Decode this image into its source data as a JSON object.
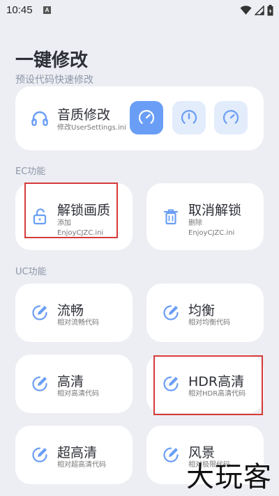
{
  "status_bar": {
    "time": "10:45",
    "app_badge": "A",
    "icons": [
      "wifi-icon",
      "signal-icon",
      "battery-icon"
    ]
  },
  "header": {
    "title": "一键修改",
    "subtitle": "预设代码快速修改"
  },
  "audio_card": {
    "title": "音质修改",
    "subtitle": "修改UserSettings.ini",
    "icon": "headphones-icon",
    "options": [
      {
        "icon": "gauge-high-icon",
        "active": true
      },
      {
        "icon": "gauge-mid-icon",
        "active": false
      },
      {
        "icon": "gauge-low-icon",
        "active": false
      }
    ]
  },
  "ec_section": {
    "label": "EC功能",
    "cards": [
      {
        "title": "解锁画质",
        "sub1": "添加",
        "sub2": "EnjoyCJZC.ini",
        "icon": "lock-open-icon"
      },
      {
        "title": "取消解锁",
        "sub1": "删除",
        "sub2": "EnjoyCJZC.ini",
        "icon": "trash-icon"
      }
    ]
  },
  "uc_section": {
    "label": "UC功能",
    "cards": [
      {
        "title": "流畅",
        "sub": "相对流畅代码",
        "icon": "edit-icon"
      },
      {
        "title": "均衡",
        "sub": "相对均衡代码",
        "icon": "edit-icon"
      },
      {
        "title": "高清",
        "sub": "相对高清代码",
        "icon": "edit-icon"
      },
      {
        "title": "HDR高清",
        "sub": "相对HDR高清代码",
        "icon": "edit-icon"
      },
      {
        "title": "超高清",
        "sub": "相对超高清代码",
        "icon": "edit-icon"
      },
      {
        "title": "风景",
        "sub": "相对极限代码",
        "icon": "edit-icon"
      }
    ]
  },
  "watermark": "大玩客",
  "colors": {
    "accent": "#6a9ef6",
    "accent_light": "#e3ecfb",
    "background": "#eceef3",
    "highlight": "#d63a3a"
  }
}
